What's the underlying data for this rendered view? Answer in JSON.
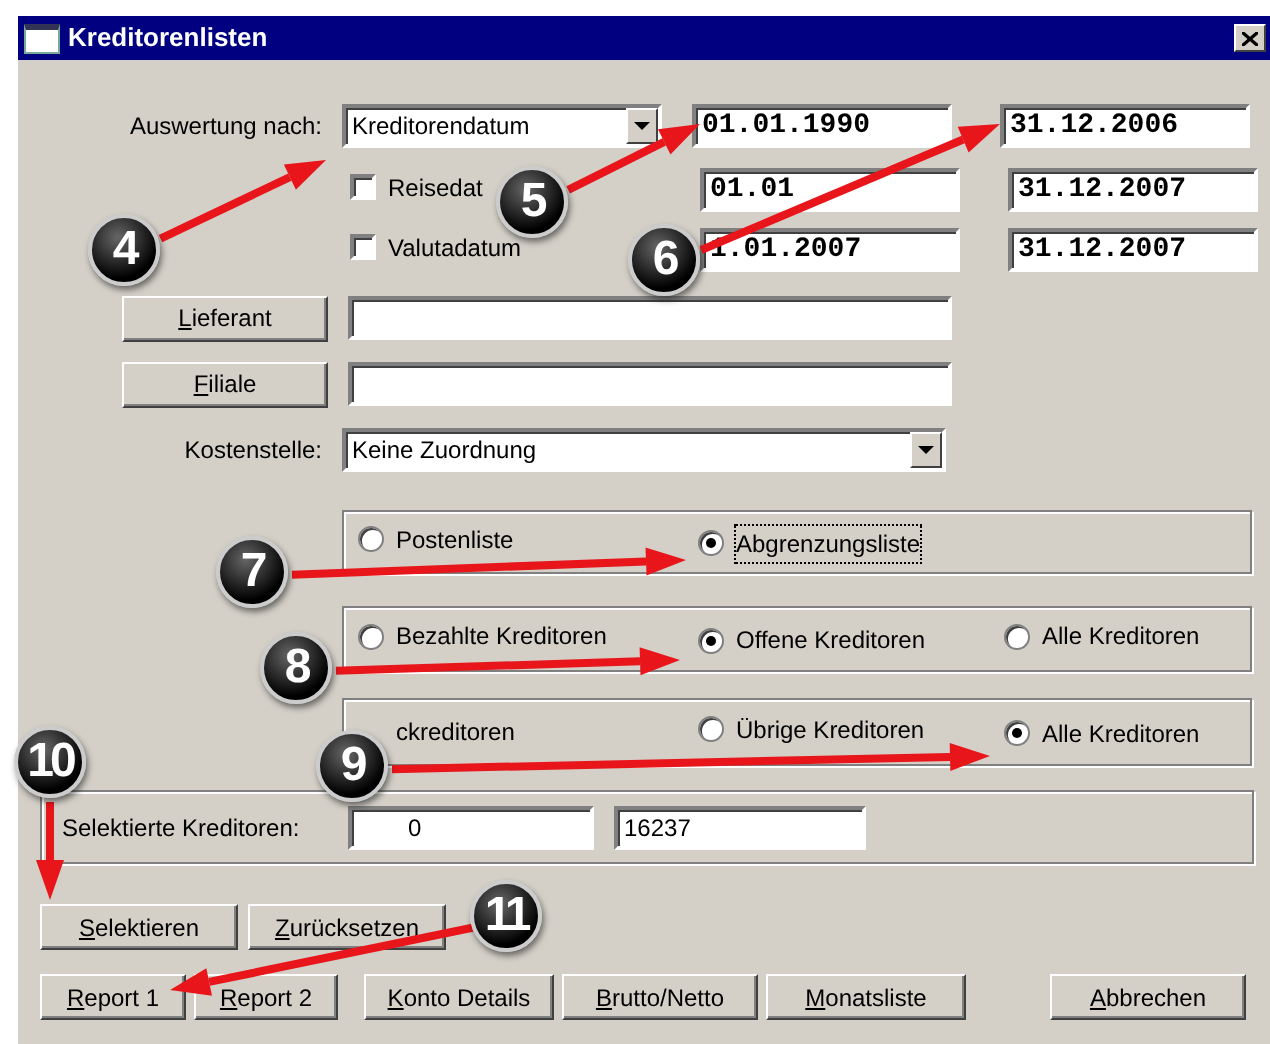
{
  "window": {
    "title": "Kreditorenlisten"
  },
  "evaluation": {
    "label": "Auswertung nach:",
    "value": "Kreditorendatum",
    "from": "01.01.1990",
    "to": "31.12.2006"
  },
  "date_options": [
    {
      "label": "Reisedat",
      "checked": false,
      "from": "01.01",
      "to": "31.12.2007"
    },
    {
      "label": "Valutadatum",
      "checked": false,
      "from": "1.01.2007",
      "to": "31.12.2007"
    }
  ],
  "lookup_fields": [
    {
      "button": "Lieferant"
    },
    {
      "button": "Filiale"
    }
  ],
  "cost_center": {
    "label": "Kostenstelle:",
    "value": "Keine Zuordnung"
  },
  "option_groups": [
    {
      "options": [
        {
          "label": "Postenliste",
          "selected": false,
          "focused": false
        },
        {
          "label": "Abgrenzungsliste",
          "selected": true,
          "focused": true
        }
      ]
    },
    {
      "options": [
        {
          "label": "Bezahlte Kreditoren",
          "selected": false,
          "focused": false
        },
        {
          "label": "Offene Kreditoren",
          "selected": true,
          "focused": false
        },
        {
          "label": "Alle Kreditoren",
          "selected": false,
          "focused": false
        }
      ]
    },
    {
      "options": [
        {
          "label": "ckreditoren",
          "focused": false
        },
        {
          "label": "Übrige Kreditoren",
          "selected": false,
          "focused": false
        },
        {
          "label": "Alle Kreditoren",
          "selected": true,
          "focused": false
        }
      ]
    }
  ],
  "selected_count": {
    "label": "Selektierte Kreditoren:",
    "values": [
      "0",
      "16237"
    ]
  },
  "action_buttons": [
    "Selektieren",
    "Zurücksetzen"
  ],
  "footer_buttons": [
    "Report 1",
    "Report 2",
    "Konto Details",
    "Brutto/Netto",
    "Monatsliste",
    "Abbrechen"
  ],
  "annotations": [
    "4",
    "5",
    "6",
    "7",
    "8",
    "9",
    "10",
    "11"
  ]
}
